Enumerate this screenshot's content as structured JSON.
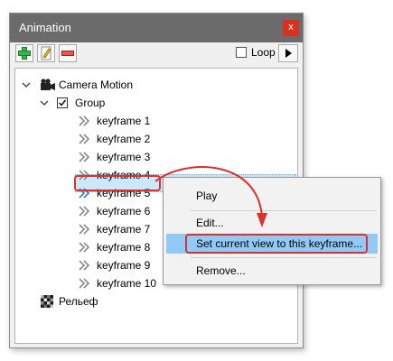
{
  "window": {
    "title": "Animation",
    "close_label": "x"
  },
  "toolbar": {
    "add_icon": "add-green-plus-icon",
    "edit_icon": "pencil-edit-icon",
    "remove_icon": "remove-red-minus-icon",
    "loop_label": "Loop",
    "loop_checked": false,
    "play_icon": "play-triangle-icon"
  },
  "tree": {
    "camera_motion": "Camera Motion",
    "group": "Group",
    "group_checked": true,
    "keyframes": [
      "keyframe 1",
      "keyframe 2",
      "keyframe 3",
      "keyframe 4",
      "keyframe 5",
      "keyframe 6",
      "keyframe 7",
      "keyframe 8",
      "keyframe 9",
      "keyframe 10"
    ],
    "selected_keyframe": "keyframe 5",
    "relief": "Рельеф"
  },
  "context_menu": {
    "items": [
      "Play",
      "Edit...",
      "Set current view to this keyframe...",
      "Remove..."
    ],
    "highlighted": "Set current view to this keyframe..."
  },
  "colors": {
    "titlebar": "#6b6b6b",
    "close_button": "#d8321f",
    "annotation_red": "#d8322c",
    "selection_blue": "#cce8ff",
    "menu_highlight": "#91c9f7"
  }
}
